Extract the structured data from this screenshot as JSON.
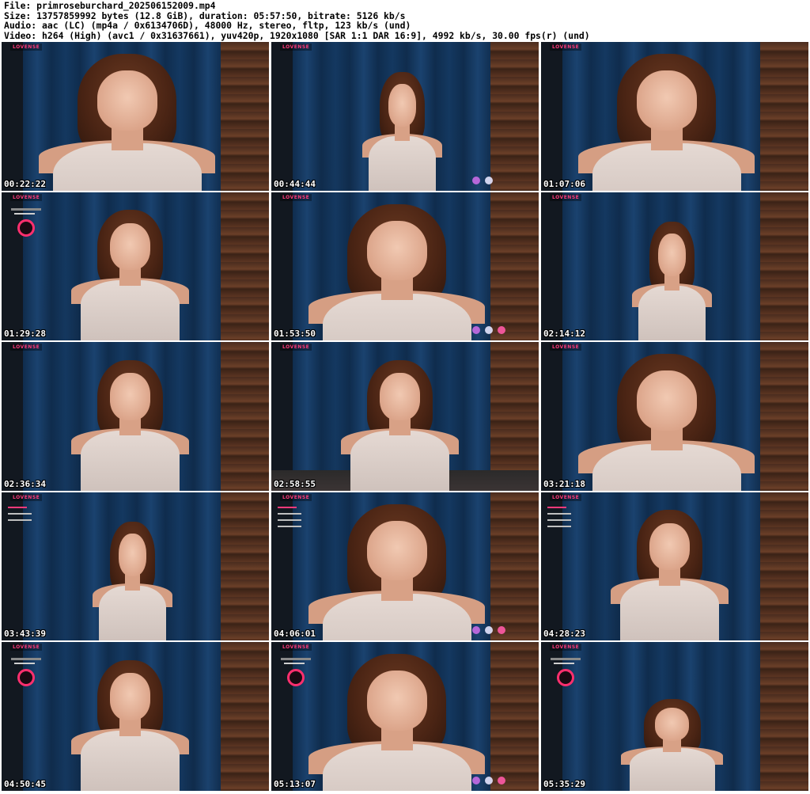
{
  "header": {
    "line1": "File: primroseburchard_202506152009.mp4",
    "line2": "Size: 13757859992 bytes (12.8 GiB), duration: 05:57:50, bitrate: 5126 kb/s",
    "line3": "Audio: aac (LC) (mp4a / 0x6134706D), 48000 Hz, stereo, fltp, 123 kb/s (und)",
    "line4": "Video: h264 (High) (avc1 / 0x31637661), yuv420p, 1920x1080 [SAR 1:1 DAR 16:9], 4992 kb/s, 30.00 fps(r) (und)"
  },
  "overlay_logo": "LOVENSE",
  "thumbnails": [
    {
      "timestamp": "00:22:22"
    },
    {
      "timestamp": "00:44:44"
    },
    {
      "timestamp": "01:07:06"
    },
    {
      "timestamp": "01:29:28"
    },
    {
      "timestamp": "01:53:50"
    },
    {
      "timestamp": "02:14:12"
    },
    {
      "timestamp": "02:36:34"
    },
    {
      "timestamp": "02:58:55"
    },
    {
      "timestamp": "03:21:18"
    },
    {
      "timestamp": "03:43:39"
    },
    {
      "timestamp": "04:06:01"
    },
    {
      "timestamp": "04:28:23"
    },
    {
      "timestamp": "04:50:45"
    },
    {
      "timestamp": "05:13:07"
    },
    {
      "timestamp": "05:35:29"
    }
  ]
}
